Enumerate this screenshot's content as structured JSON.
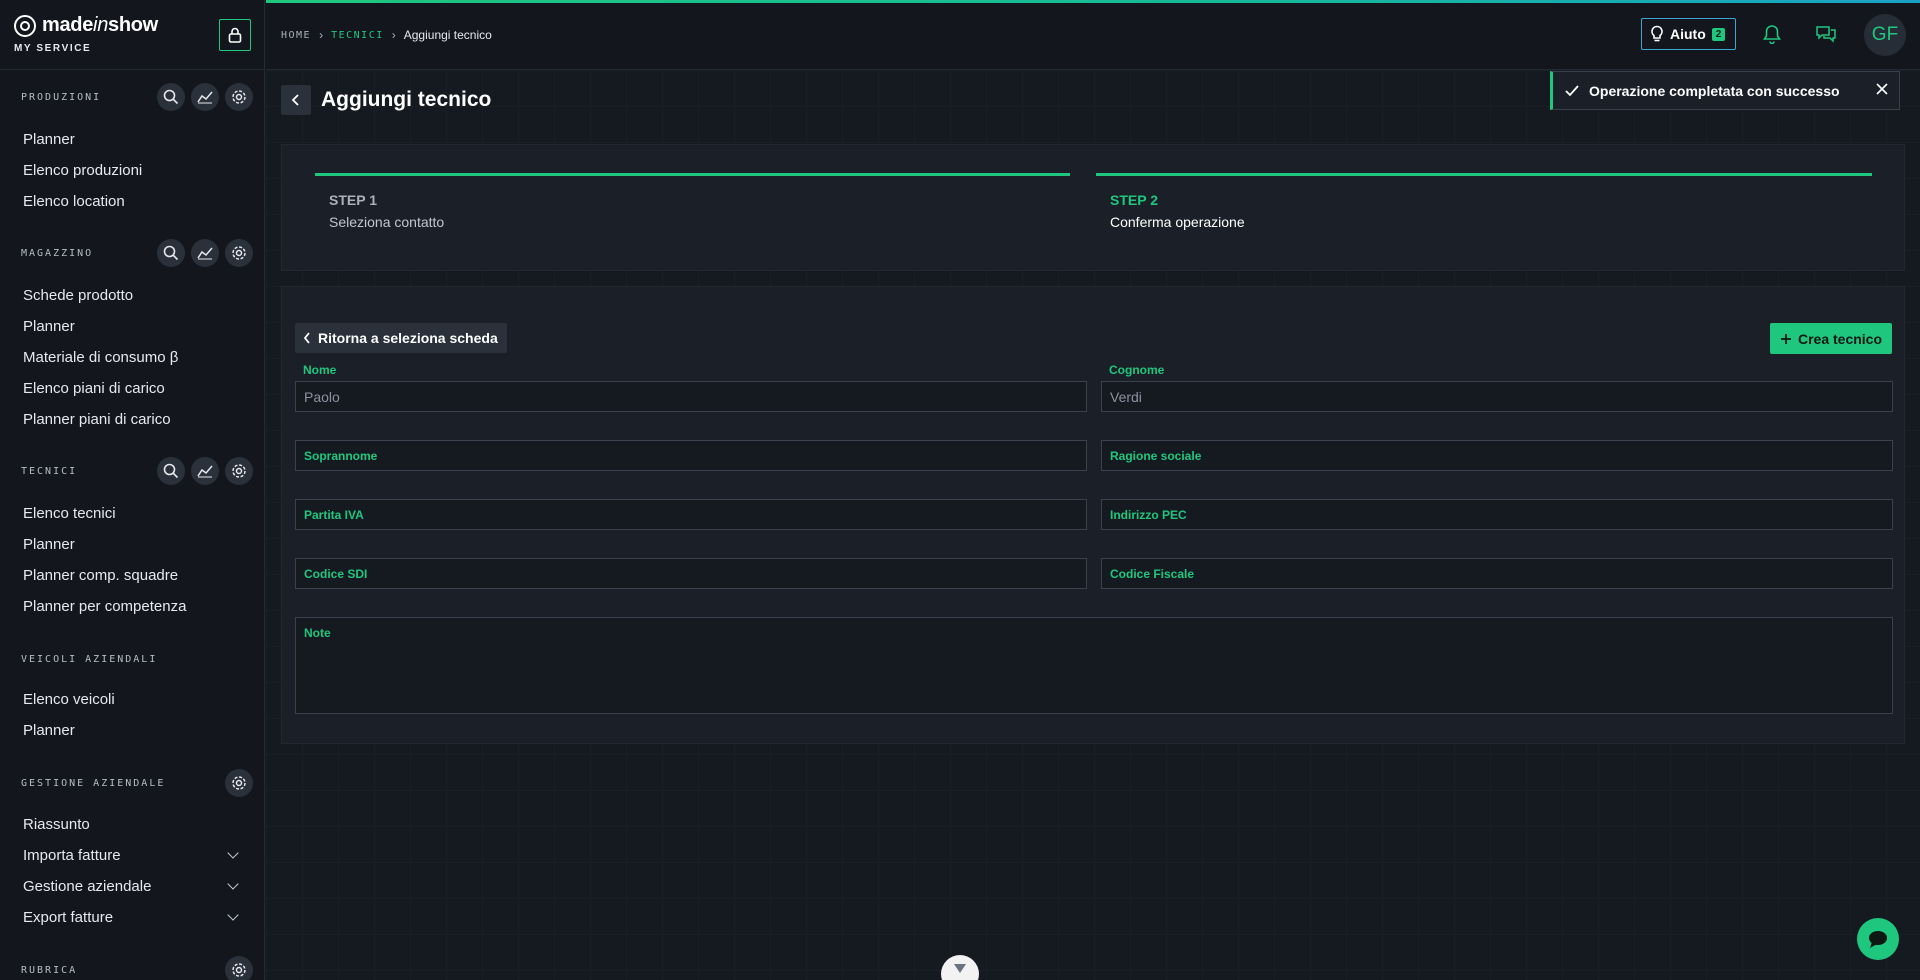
{
  "brand": {
    "name_main": "made",
    "name_italic": "in",
    "name_end": "show",
    "service": "MY SERVICE"
  },
  "sidebar": {
    "sections": [
      {
        "title": "PRODUZIONI",
        "items": [
          "Planner",
          "Elenco produzioni",
          "Elenco location"
        ]
      },
      {
        "title": "MAGAZZINO",
        "items": [
          "Schede prodotto",
          "Planner",
          "Materiale di consumo β",
          "Elenco piani di carico",
          "Planner piani di carico"
        ]
      },
      {
        "title": "TECNICI",
        "items": [
          "Elenco tecnici",
          "Planner",
          "Planner comp. squadre",
          "Planner per competenza"
        ]
      },
      {
        "title": "VEICOLI AZIENDALI",
        "items": [
          "Elenco veicoli",
          "Planner"
        ]
      },
      {
        "title": "GESTIONE AZIENDALE",
        "items": [
          "Riassunto",
          "Importa fatture",
          "Gestione aziendale",
          "Export fatture"
        ]
      },
      {
        "title": "RUBRICA",
        "items": []
      }
    ]
  },
  "breadcrumb": {
    "home": "HOME",
    "section": "TECNICI",
    "current": "Aggiungi tecnico"
  },
  "topbar": {
    "help_label": "Aiuto",
    "help_count": "2",
    "avatar_initials": "GF"
  },
  "toast": {
    "message": "Operazione completata con successo"
  },
  "page": {
    "title": "Aggiungi tecnico"
  },
  "steps": [
    {
      "label": "STEP 1",
      "description": "Seleziona contatto"
    },
    {
      "label": "STEP 2",
      "description": "Conferma operazione"
    }
  ],
  "form": {
    "return_label": "Ritorna a seleziona scheda",
    "create_label": "Crea tecnico",
    "nome_label": "Nome",
    "nome_value": "Paolo",
    "cognome_label": "Cognome",
    "cognome_value": "Verdi",
    "soprannome": "Soprannome",
    "ragione_sociale": "Ragione sociale",
    "partita_iva": "Partita IVA",
    "indirizzo_pec": "Indirizzo PEC",
    "codice_sdi": "Codice SDI",
    "codice_fiscale": "Codice Fiscale",
    "note": "Note"
  },
  "colors": {
    "accent": "#1fc77e",
    "background": "#151920",
    "panel": "#1b2028",
    "help_border": "#39a7d6"
  }
}
